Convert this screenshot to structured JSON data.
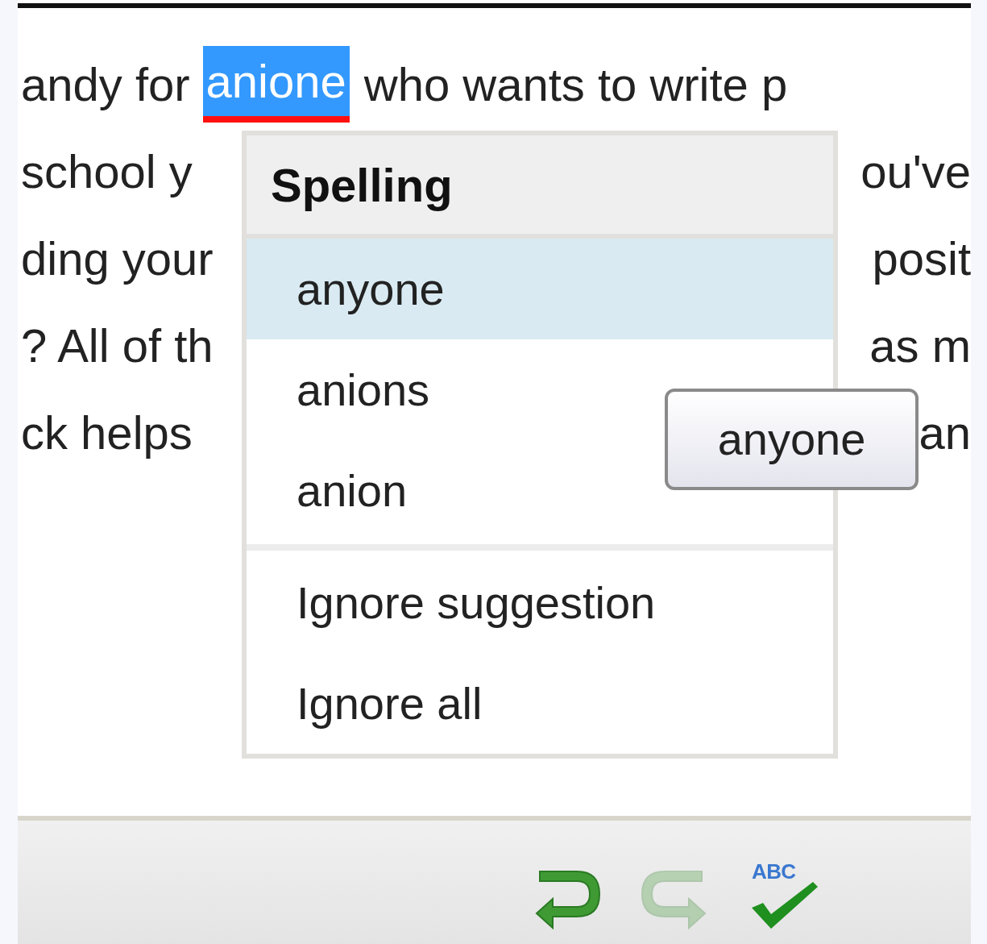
{
  "editor": {
    "lines": [
      {
        "left": "andy for",
        "flagged": "anione",
        "right": "who wants to write p"
      },
      {
        "left": "school y",
        "right": "ou've"
      },
      {
        "left": "ding your",
        "right": "posit"
      },
      {
        "left": "? All of th",
        "right": "as m"
      },
      {
        "left": "ck helps",
        "right": "an"
      }
    ]
  },
  "menu": {
    "title": "Spelling",
    "suggestions": [
      {
        "label": "anyone",
        "selected": true
      },
      {
        "label": "anions",
        "selected": false
      },
      {
        "label": "anion",
        "selected": false
      }
    ],
    "actions": [
      "Ignore suggestion",
      "Ignore all"
    ]
  },
  "tooltip": {
    "text": "anyone"
  },
  "toolbar": {
    "buttons": [
      {
        "kind": "undo",
        "disabled": false
      },
      {
        "kind": "redo",
        "disabled": true
      },
      {
        "kind": "spellcheck",
        "label": "ABC",
        "disabled": false
      }
    ]
  }
}
